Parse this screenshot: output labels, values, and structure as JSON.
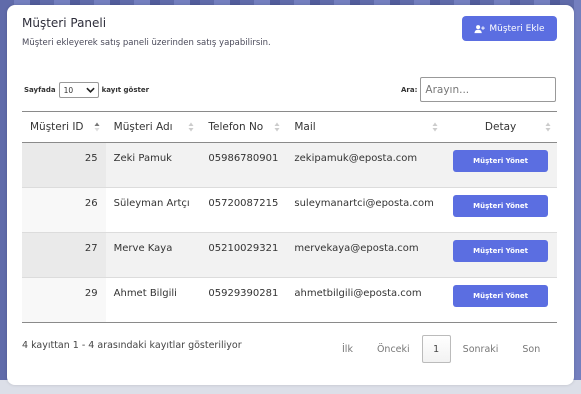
{
  "colors": {
    "accent": "#5b6ee1",
    "background": "#6c76b8"
  },
  "header": {
    "title": "Müşteri Paneli",
    "subtitle": "Müşteri ekleyerek satış paneli üzerinden satış yapabilirsin.",
    "add_button_label": "Müşteri Ekle",
    "add_button_icon": "user-plus-icon"
  },
  "controls": {
    "length_prefix": "Sayfada",
    "length_value": "10",
    "length_suffix": "kayıt göster",
    "search_label": "Ara:",
    "search_placeholder": "Arayın..."
  },
  "table": {
    "headers": {
      "id": "Müşteri ID",
      "name": "Müşteri Adı",
      "phone": "Telefon No",
      "mail": "Mail",
      "detail": "Detay"
    },
    "rows": [
      {
        "id": "25",
        "name": "Zeki Pamuk",
        "phone": "05986780901",
        "mail": "zekipamuk@eposta.com",
        "action": "Müşteri Yönet"
      },
      {
        "id": "26",
        "name": "Süleyman Artçı",
        "phone": "05720087215",
        "mail": "suleymanartci@eposta.com",
        "action": "Müşteri Yönet"
      },
      {
        "id": "27",
        "name": "Merve Kaya",
        "phone": "05210029321",
        "mail": "mervekaya@eposta.com",
        "action": "Müşteri Yönet"
      },
      {
        "id": "29",
        "name": "Ahmet Bilgili",
        "phone": "05929390281",
        "mail": "ahmetbilgili@eposta.com",
        "action": "Müşteri Yönet"
      }
    ]
  },
  "footer": {
    "info": "4 kayıttan 1 - 4 arasındaki kayıtlar gösteriliyor",
    "first": "İlk",
    "previous": "Önceki",
    "current_page": "1",
    "next": "Sonraki",
    "last": "Son"
  }
}
